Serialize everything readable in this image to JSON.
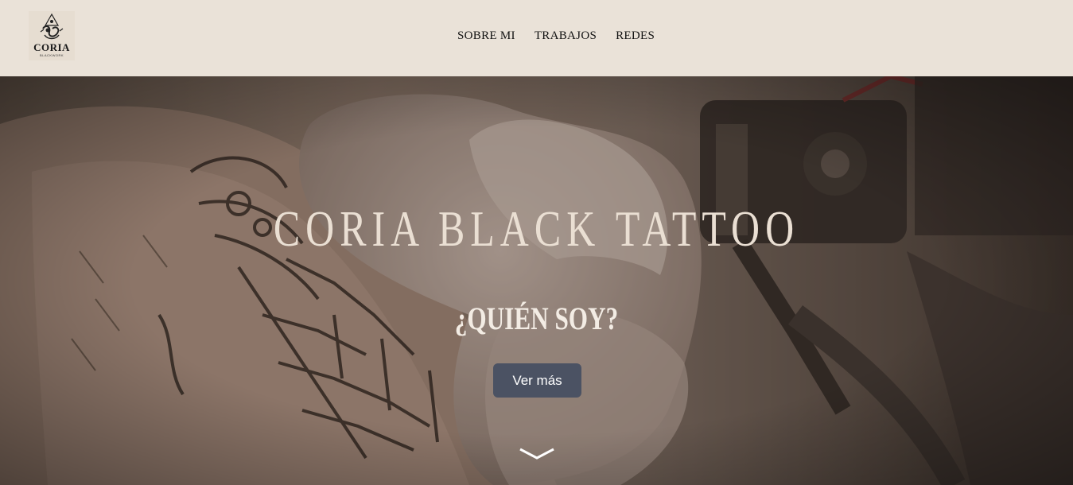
{
  "header": {
    "logo_text": "CORIA",
    "logo_sub": "BLACKWORK",
    "nav": [
      {
        "label": "SOBRE MI"
      },
      {
        "label": "TRABAJOS"
      },
      {
        "label": "REDES"
      }
    ]
  },
  "hero": {
    "title": "CORIA BLACK TATTOO",
    "subtitle": "¿QUIÉN SOY?",
    "button_label": "Ver más",
    "scroll_icon": "chevron-down-icon"
  },
  "colors": {
    "header_bg": "#eae2d8",
    "button_bg": "#4b5263",
    "title_color": "#eadfd3"
  }
}
